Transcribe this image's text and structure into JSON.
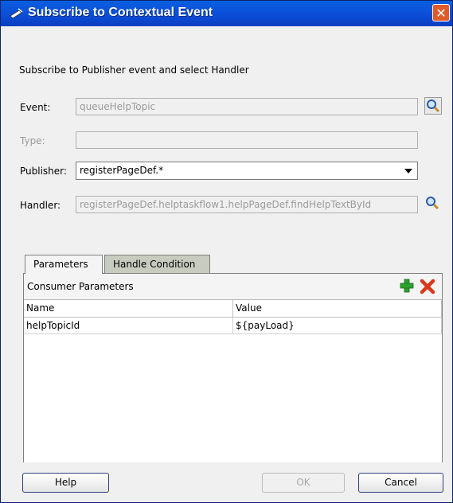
{
  "window": {
    "title": "Subscribe to Contextual Event",
    "close_symbol": "✕"
  },
  "subtitle": "Subscribe to Publisher event and select Handler",
  "event": {
    "label": "Event:",
    "value": "queueHelpTopic"
  },
  "type": {
    "label": "Type:",
    "value": ""
  },
  "publisher": {
    "label": "Publisher:",
    "value": "registerPageDef.*"
  },
  "handler": {
    "label": "Handler:",
    "value": "registerPageDef.helptaskflow1.helpPageDef.findHelpTextById"
  },
  "tabs": [
    {
      "label": "Parameters",
      "active": true
    },
    {
      "label": "Handle Condition",
      "active": false
    }
  ],
  "consumer_parameters": {
    "title": "Consumer Parameters",
    "columns": [
      "Name",
      "Value"
    ],
    "rows": [
      {
        "name": "helpTopicId",
        "value": "${payLoad}"
      }
    ]
  },
  "buttons": {
    "help": "Help",
    "ok": "OK",
    "cancel": "Cancel"
  },
  "colors": {
    "titlebar": "#0c4cd6",
    "add_icon": "#2ea02e",
    "delete_icon": "#d63a1a"
  }
}
